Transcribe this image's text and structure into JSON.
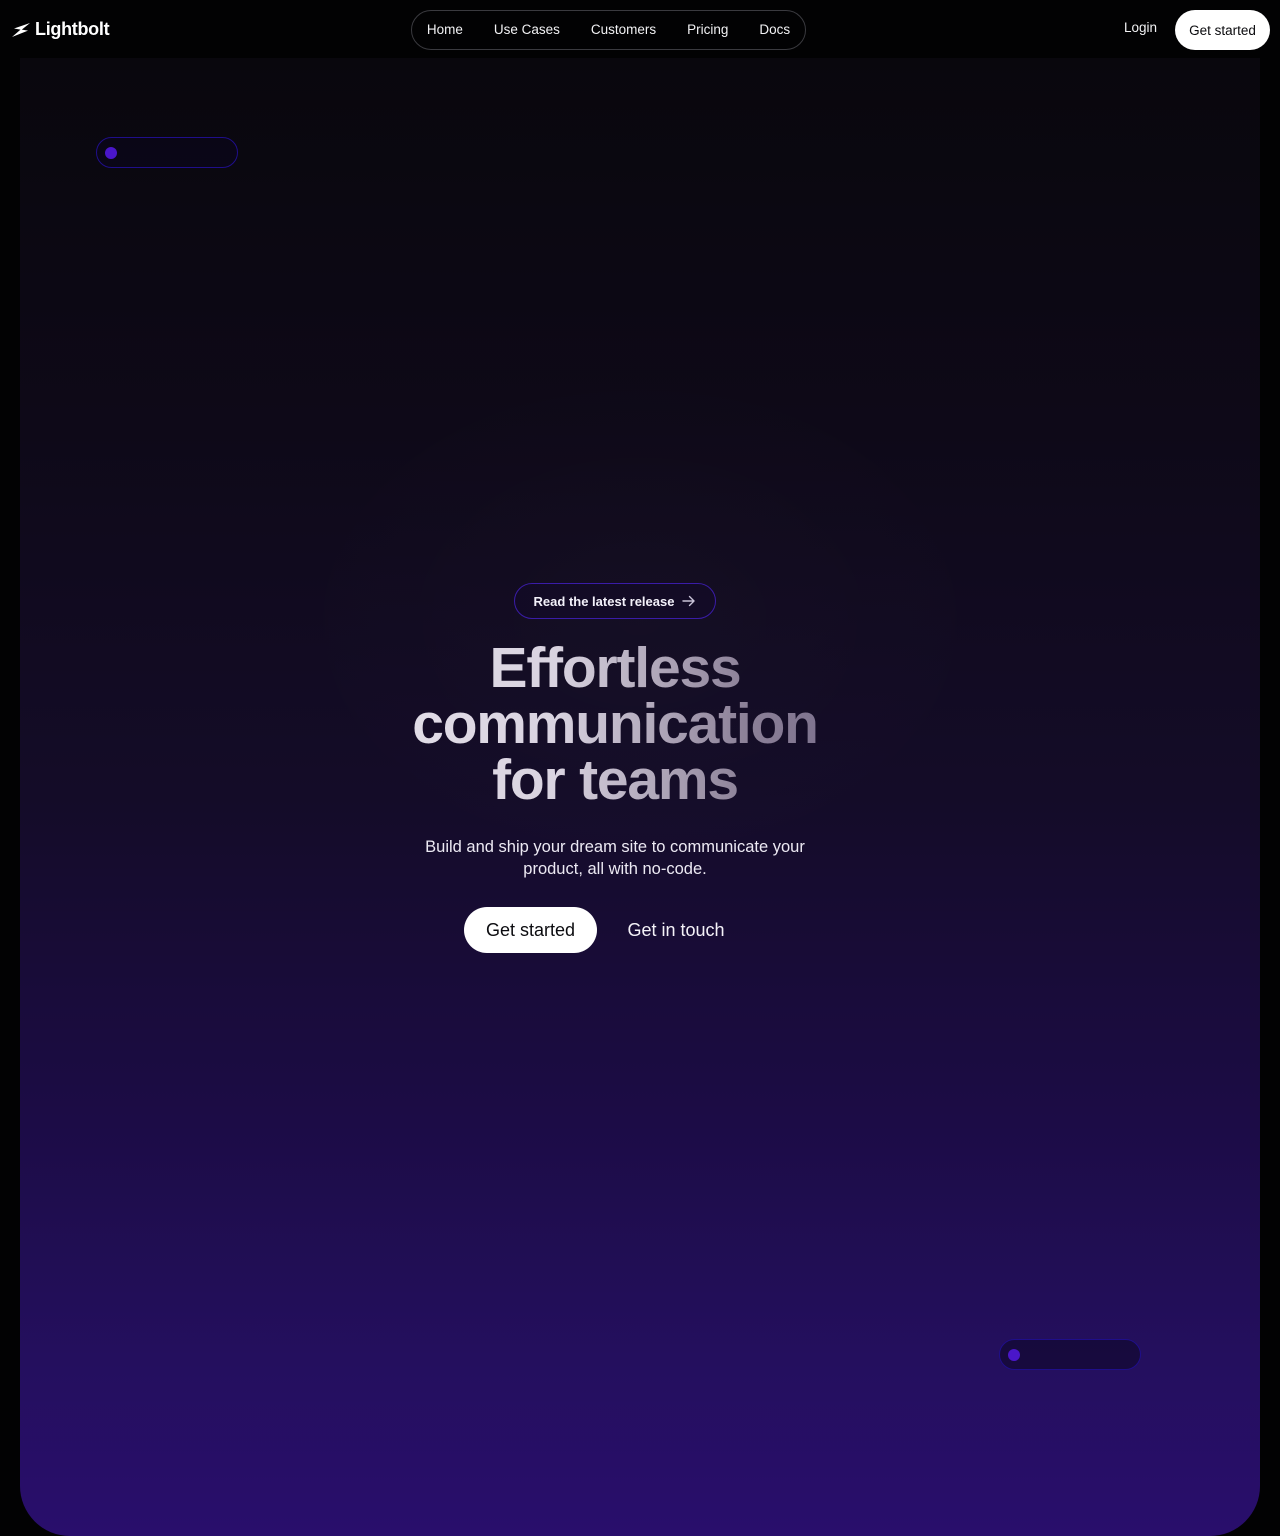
{
  "header": {
    "brand": "Lightbolt",
    "nav": [
      "Home",
      "Use Cases",
      "Customers",
      "Pricing",
      "Docs"
    ],
    "login": "Login",
    "cta": "Get started"
  },
  "hero": {
    "badge": "Read the latest release",
    "headline": [
      "Effortless",
      "communication",
      "for teams"
    ],
    "subtitle": "Build and ship your dream site to communicate your product, all with no-code.",
    "primary_cta": "Get started",
    "secondary_cta": "Get in touch"
  },
  "icons": {
    "logo": "lightning-bolt-icon",
    "badge_arrow": "arrow-right-icon"
  },
  "colors": {
    "background": "#020203",
    "accent": "#4a16c9",
    "gradient_bottom": "#290e6c"
  }
}
